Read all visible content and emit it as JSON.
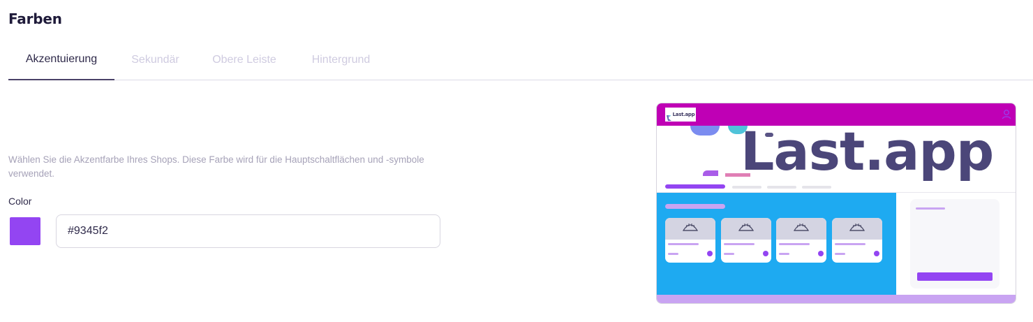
{
  "page": {
    "title": "Farben"
  },
  "tabs": [
    {
      "label": "Akzentuierung",
      "active": true
    },
    {
      "label": "Sekundär",
      "active": false
    },
    {
      "label": "Obere Leiste",
      "active": false
    },
    {
      "label": "Hintergrund",
      "active": false
    }
  ],
  "settings": {
    "description": "Wählen Sie die Akzentfarbe Ihres Shops. Diese Farbe wird für die Hauptschaltflächen und -symbole verwendet.",
    "color_label": "Color",
    "color_value": "#9345f2"
  },
  "preview": {
    "logo_text": "Last.app",
    "hero_text": "Last.app",
    "colors": {
      "top_bar": "#bf00b5",
      "accent": "#9345f2",
      "accent_light": "#c9a4f2",
      "main_background": "#1eaaf1",
      "bottom_bar": "#c9a4f2"
    },
    "icons": {
      "user": "user-icon",
      "product": "dumpling-icon"
    }
  }
}
